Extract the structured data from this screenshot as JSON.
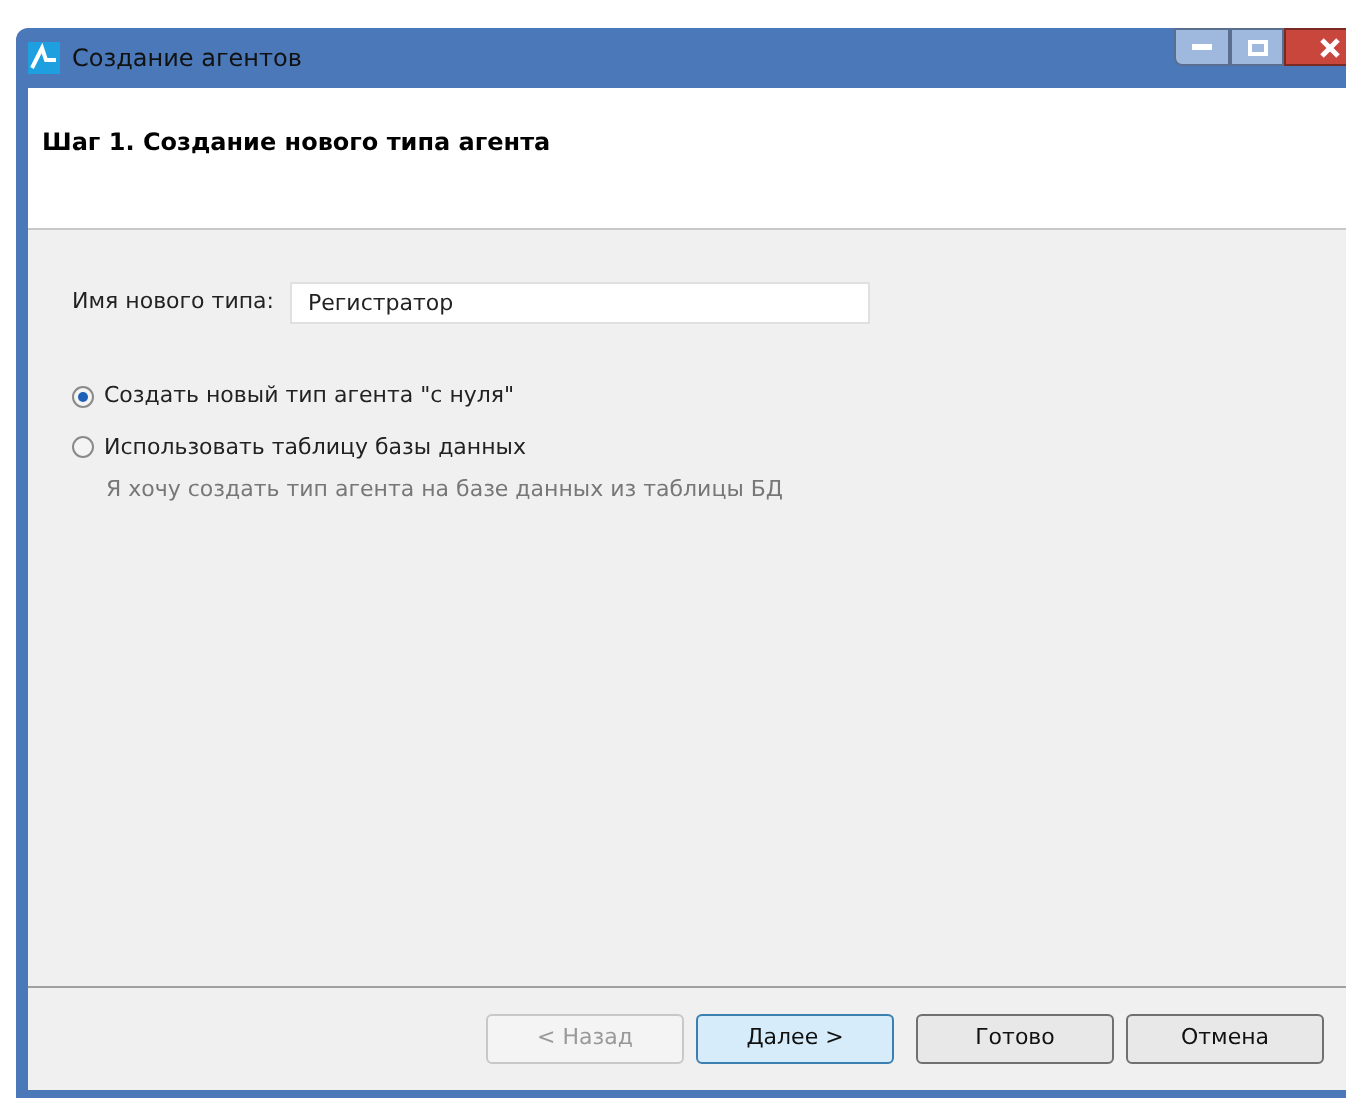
{
  "window": {
    "title": "Создание агентов"
  },
  "header": {
    "title": "Шаг 1. Создание нового типа агента"
  },
  "name_field": {
    "label": "Имя нового типа:",
    "value": "Регистратор"
  },
  "options": [
    {
      "label": "Создать новый тип агента \"с нуля\"",
      "selected": true
    },
    {
      "label": "Использовать таблицу базы данных",
      "selected": false,
      "hint": "Я хочу создать тип агента на базе данных из таблицы БД"
    }
  ],
  "buttons": [
    {
      "label": "< Назад",
      "disabled": true,
      "default": false
    },
    {
      "label": "Далее >",
      "disabled": false,
      "default": true
    },
    {
      "label": "Готово",
      "disabled": false,
      "default": false
    },
    {
      "label": "Отмена",
      "disabled": false,
      "default": false
    }
  ]
}
